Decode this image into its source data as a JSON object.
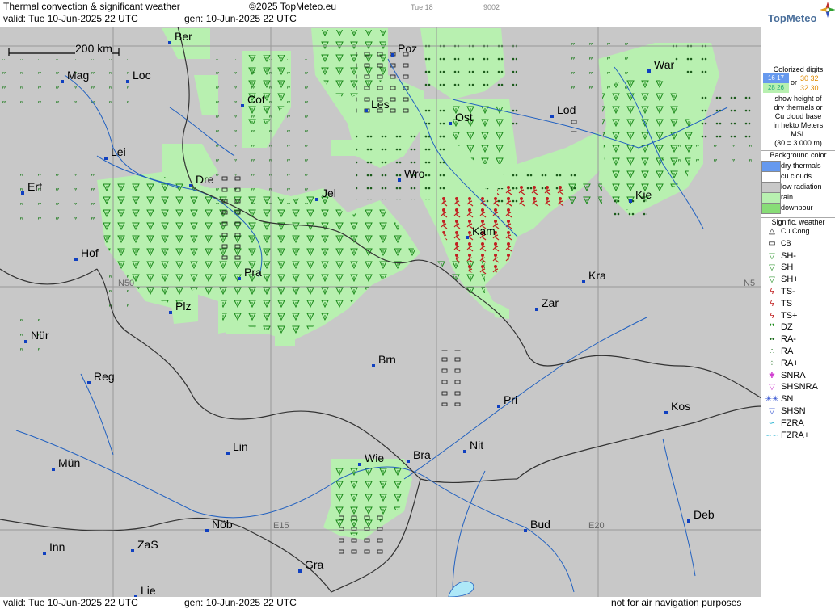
{
  "header": {
    "title": "Thermal convection & significant weather",
    "copyright": "©2025 TopMeteo.eu",
    "run_label": "Tue 18",
    "code": "9002",
    "valid": "valid:  Tue  10-Jun-2025  22 UTC",
    "gen": "gen: 10-Jun-2025 22 UTC"
  },
  "logo": {
    "text": "TopMeteo"
  },
  "footer": {
    "valid": "valid:  Tue  10-Jun-2025  22 UTC",
    "gen": "gen: 10-Jun-2025 22 UTC",
    "disclaimer": "not for air navigation purposes"
  },
  "scale": {
    "label": "200 km"
  },
  "grid_labels": {
    "n50_left": "N50",
    "n50_right": "N5",
    "e15": "E15",
    "e20": "E20"
  },
  "cities": [
    {
      "name": "Ber"
    },
    {
      "name": "Poz"
    },
    {
      "name": "War"
    },
    {
      "name": "Mag"
    },
    {
      "name": "Loc"
    },
    {
      "name": "Cot"
    },
    {
      "name": "Les"
    },
    {
      "name": "Lod"
    },
    {
      "name": "Ost"
    },
    {
      "name": "Lei"
    },
    {
      "name": "Dre"
    },
    {
      "name": "Wro"
    },
    {
      "name": "Erf"
    },
    {
      "name": "Jel"
    },
    {
      "name": "Kie"
    },
    {
      "name": "Kam"
    },
    {
      "name": "Hof"
    },
    {
      "name": "Pra"
    },
    {
      "name": "Kra"
    },
    {
      "name": "Plz"
    },
    {
      "name": "Zar"
    },
    {
      "name": "Nür"
    },
    {
      "name": "Brn"
    },
    {
      "name": "Reg"
    },
    {
      "name": "Pri"
    },
    {
      "name": "Kos"
    },
    {
      "name": "Lin"
    },
    {
      "name": "Nit"
    },
    {
      "name": "Wie"
    },
    {
      "name": "Bra"
    },
    {
      "name": "Mün"
    },
    {
      "name": "Deb"
    },
    {
      "name": "Nöb"
    },
    {
      "name": "Bud"
    },
    {
      "name": "Inn"
    },
    {
      "name": "ZaS"
    },
    {
      "name": "Gra"
    },
    {
      "name": "Lie"
    }
  ],
  "legend": {
    "colorized_title": "Colorized digits",
    "digits_a": "16 17",
    "digits_b": "28 26",
    "or": "or",
    "digits_c": "30 32",
    "digits_d": "32 30",
    "desc1": "show height of",
    "desc2": "dry thermals or",
    "desc3": "Cu cloud base",
    "desc4": "in hekto Meters",
    "desc5": "MSL",
    "desc6": "(30 = 3.000 m)",
    "bg_title": "Background color",
    "bg_items": [
      {
        "label": "dry thermals",
        "color": "#6699ee"
      },
      {
        "label": "cu clouds",
        "color": "#ffffff"
      },
      {
        "label": "low radiation",
        "color": "#c8c8c8"
      },
      {
        "label": "rain",
        "color": "#b8f0b0"
      },
      {
        "label": "downpour",
        "color": "#88dd77"
      }
    ],
    "sig_title": "Signific. weather",
    "sig_items": [
      {
        "label": "Cu Cong",
        "symbol": "△",
        "color": "#000"
      },
      {
        "label": "CB",
        "symbol": "▭",
        "color": "#000"
      },
      {
        "label": "SH-",
        "symbol": "▽",
        "color": "#1a8a1a"
      },
      {
        "label": "SH",
        "symbol": "▽",
        "color": "#1a8a1a"
      },
      {
        "label": "SH+",
        "symbol": "▽",
        "color": "#1a8a1a"
      },
      {
        "label": "TS-",
        "symbol": "ϟ",
        "color": "#c02020"
      },
      {
        "label": "TS",
        "symbol": "ϟ",
        "color": "#c02020"
      },
      {
        "label": "TS+",
        "symbol": "ϟ",
        "color": "#c02020"
      },
      {
        "label": "DZ",
        "symbol": "❜❜",
        "color": "#1a8a1a"
      },
      {
        "label": "RA-",
        "symbol": "••",
        "color": "#1a6a1a"
      },
      {
        "label": "RA",
        "symbol": "∴",
        "color": "#1a6a1a"
      },
      {
        "label": "RA+",
        "symbol": "⁘",
        "color": "#1a6a1a"
      },
      {
        "label": "SNRA",
        "symbol": "✱",
        "color": "#d040d0"
      },
      {
        "label": "SHSNRA",
        "symbol": "▽",
        "color": "#d040d0"
      },
      {
        "label": "SN",
        "symbol": "✳✳",
        "color": "#3050d0"
      },
      {
        "label": "SHSN",
        "symbol": "▽",
        "color": "#3050d0"
      },
      {
        "label": "FZRA",
        "symbol": "∽",
        "color": "#20b0d0"
      },
      {
        "label": "FZRA+",
        "symbol": "∽∽",
        "color": "#20b0d0"
      }
    ]
  },
  "colors": {
    "map_bg": "#c8c8c8",
    "rain": "#b8f0b0",
    "downpour": "#88dd77",
    "border": "#333333",
    "river": "#2060c0",
    "grid": "#999999",
    "city_dot": "#1040c0"
  }
}
